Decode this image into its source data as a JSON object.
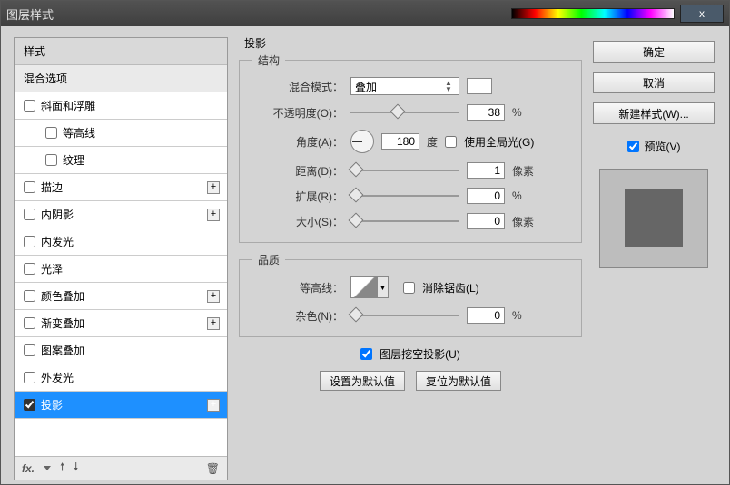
{
  "titlebar": {
    "title": "图层样式",
    "close": "x"
  },
  "left": {
    "headStyles": "样式",
    "headBlend": "混合选项",
    "item_bevel": "斜面和浮雕",
    "item_contour": "等高线",
    "item_texture": "纹理",
    "item_stroke": "描边",
    "item_innerShadow": "内阴影",
    "item_innerGlow": "内发光",
    "item_satin": "光泽",
    "item_colorOverlay": "颜色叠加",
    "item_gradientOverlay": "渐变叠加",
    "item_patternOverlay": "图案叠加",
    "item_outerGlow": "外发光",
    "item_dropShadow": "投影",
    "plus": "+",
    "fx": "fx."
  },
  "center": {
    "title": "投影",
    "structureLegend": "结构",
    "qualityLegend": "品质",
    "blendModeLabel": "混合模式：",
    "blendModeValue": "叠加",
    "opacityLabel": "不透明度(O)：",
    "opacityValue": "38",
    "opacityUnit": "%",
    "angleLabel": "角度(A)：",
    "angleValue": "180",
    "angleUnit": "度",
    "globalLightLabel": "使用全局光(G)",
    "distanceLabel": "距离(D)：",
    "distanceValue": "1",
    "distanceUnit": "像素",
    "spreadLabel": "扩展(R)：",
    "spreadValue": "0",
    "spreadUnit": "%",
    "sizeLabel": "大小(S)：",
    "sizeValue": "0",
    "sizeUnit": "像素",
    "contourLabel": "等高线：",
    "antiAliasLabel": "消除锯齿(L)",
    "noiseLabel": "杂色(N)：",
    "noiseValue": "0",
    "noiseUnit": "%",
    "knockoutLabel": "图层挖空投影(U)",
    "setDefault": "设置为默认值",
    "resetDefault": "复位为默认值"
  },
  "right": {
    "ok": "确定",
    "cancel": "取消",
    "newStyle": "新建样式(W)...",
    "previewLabel": "预览(V)"
  }
}
